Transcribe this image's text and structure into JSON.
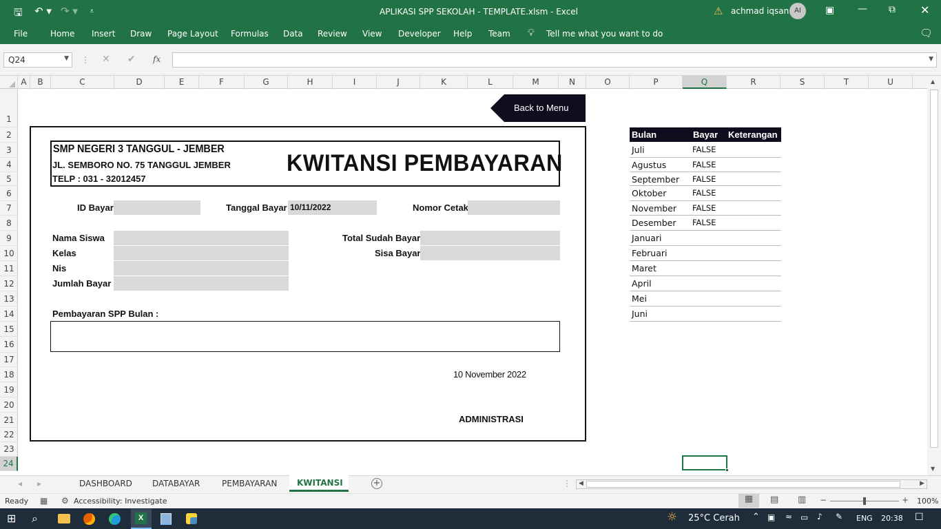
{
  "window": {
    "title": "APLIKASI SPP SEKOLAH - TEMPLATE.xlsm  -  Excel",
    "user": "achmad iqsan",
    "user_initials": "AI"
  },
  "ribbon": {
    "tabs": [
      "File",
      "Home",
      "Insert",
      "Draw",
      "Page Layout",
      "Formulas",
      "Data",
      "Review",
      "View",
      "Developer",
      "Help",
      "Team"
    ],
    "tell_me": "Tell me what you want to do"
  },
  "formula_bar": {
    "name_box": "Q24",
    "fx": "fx",
    "formula": ""
  },
  "columns": [
    "A",
    "B",
    "C",
    "D",
    "E",
    "F",
    "G",
    "H",
    "I",
    "J",
    "K",
    "L",
    "M",
    "N",
    "O",
    "P",
    "Q",
    "R",
    "S",
    "T",
    "U"
  ],
  "rows": [
    "1",
    "2",
    "3",
    "4",
    "5",
    "6",
    "7",
    "8",
    "9",
    "10",
    "11",
    "12",
    "13",
    "14",
    "15",
    "16",
    "17",
    "18",
    "19",
    "20",
    "21",
    "22",
    "23",
    "24"
  ],
  "back_button": "Back to Menu",
  "receipt": {
    "school": "SMP NEGERI 3 TANGGUL - JEMBER",
    "address": "JL. SEMBORO NO. 75 TANGGUL JEMBER",
    "phone": "TELP : 031 - 32012457",
    "heading": "KWITANSI PEMBAYARAN",
    "id_label": "ID Bayar",
    "date_label": "Tanggal Bayar",
    "date_value": "10/11/2022",
    "print_label": "Nomor Cetak",
    "name_label": "Nama Siswa",
    "class_label": "Kelas",
    "nis_label": "Nis",
    "amount_label": "Jumlah Bayar",
    "total_label": "Total Sudah Bayar",
    "remaining_label": "Sisa Bayar",
    "months_label": "Pembayaran SPP Bulan :",
    "sign_date": "10 November 2022",
    "signatory": "ADMINISTRASI"
  },
  "month_table": {
    "headers": [
      "Bulan",
      "Bayar",
      "Keterangan"
    ],
    "rows": [
      {
        "month": "Juli",
        "paid": "FALSE"
      },
      {
        "month": "Agustus",
        "paid": "FALSE"
      },
      {
        "month": "September",
        "paid": "FALSE"
      },
      {
        "month": "Oktober",
        "paid": "FALSE"
      },
      {
        "month": "November",
        "paid": "FALSE"
      },
      {
        "month": "Desember",
        "paid": "FALSE"
      },
      {
        "month": "Januari",
        "paid": ""
      },
      {
        "month": "Februari",
        "paid": ""
      },
      {
        "month": "Maret",
        "paid": ""
      },
      {
        "month": "April",
        "paid": ""
      },
      {
        "month": "Mei",
        "paid": ""
      },
      {
        "month": "Juni",
        "paid": ""
      }
    ]
  },
  "sheets": [
    "DASHBOARD",
    "DATABAYAR",
    "PEMBAYARAN",
    "KWITANSI"
  ],
  "active_sheet": "KWITANSI",
  "status": {
    "ready": "Ready",
    "accessibility": "Accessibility: Investigate",
    "zoom": "100%"
  },
  "taskbar": {
    "weather": "25°C  Cerah",
    "lang": "ENG",
    "time": "20:38"
  },
  "colors": {
    "excel_green": "#217346",
    "table_header": "#120d1e",
    "cell_fill": "#d9d9d9"
  }
}
